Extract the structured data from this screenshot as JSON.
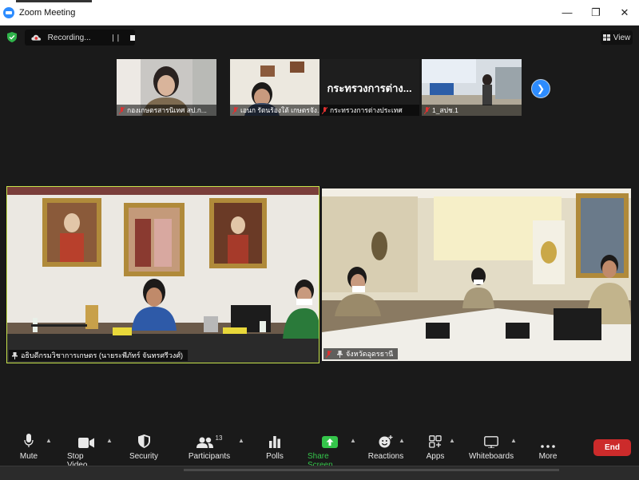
{
  "window": {
    "title": "Zoom Meeting",
    "controls": [
      "minimize",
      "restore",
      "close"
    ]
  },
  "recording": {
    "label": "Recording...",
    "pause_label": "❘❘"
  },
  "view": {
    "label": "View"
  },
  "gallery": [
    {
      "name": "กองเกษตรสารนิเทศ สป.ก...",
      "muted": true
    },
    {
      "name": "เอนก รัตนร้องใต้ เกษตรจัง...",
      "muted": true
    },
    {
      "name": "กระทรวงการต่างประเทศ",
      "display_name": "กระทรวงการต่าง...",
      "muted": true
    },
    {
      "name": "1_สปช.1",
      "muted": true
    }
  ],
  "main_videos": [
    {
      "name": "อธิบดีกรมวิชาการเกษตร (นายระพีภัทร์ จันทรศรีวงศ์)",
      "pinned": true,
      "active_speaker": true
    },
    {
      "name": "จังหวัดอุดรธานี",
      "pinned": true,
      "muted": true
    }
  ],
  "toolbar": {
    "mute": "Mute",
    "stop_video": "Stop Video",
    "security": "Security",
    "participants": "Participants",
    "participants_count": "13",
    "polls": "Polls",
    "share_screen": "Share Screen",
    "reactions": "Reactions",
    "apps": "Apps",
    "whiteboards": "Whiteboards",
    "more": "More",
    "end": "End"
  },
  "colors": {
    "accent": "#2d8cff",
    "share_green": "#35c54b",
    "end_red": "#cc2b2b",
    "speaker_border": "#c7e34b"
  }
}
